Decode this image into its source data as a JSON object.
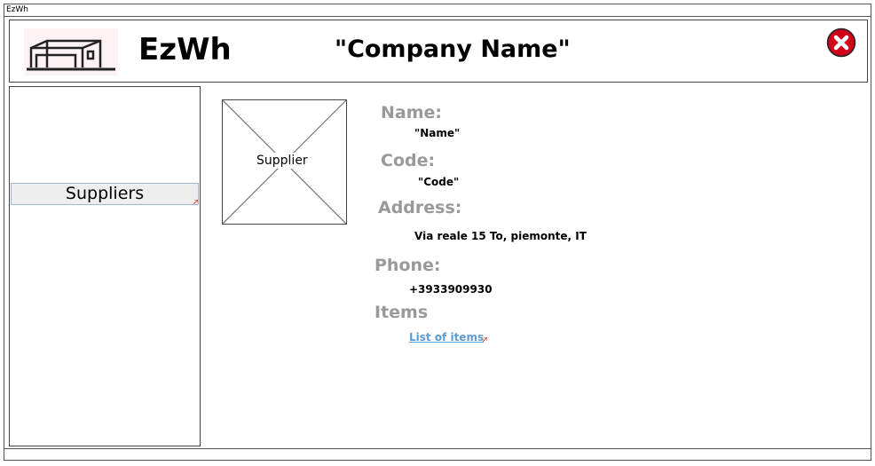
{
  "window": {
    "title": "EzWh"
  },
  "header": {
    "app_name": "EzWh",
    "company_name": "\"Company Name\"",
    "logo_icon": "warehouse-icon",
    "close_icon": "close-icon"
  },
  "sidebar": {
    "items": [
      {
        "label": "Suppliers"
      }
    ]
  },
  "supplier": {
    "image_label": "Supplier",
    "fields": {
      "name_label": "Name:",
      "name_value": "\"Name\"",
      "code_label": "Code:",
      "code_value": "\"Code\"",
      "address_label": "Address:",
      "address_value": "Via reale 15 To, piemonte, IT",
      "phone_label": "Phone:",
      "phone_value": "+3933909930",
      "items_label": "Items",
      "items_link": "List of items"
    }
  },
  "colors": {
    "close": "#d0021b",
    "label_gray": "#999999",
    "link": "#5b9bd5",
    "selected_bg": "#eeeeee"
  }
}
